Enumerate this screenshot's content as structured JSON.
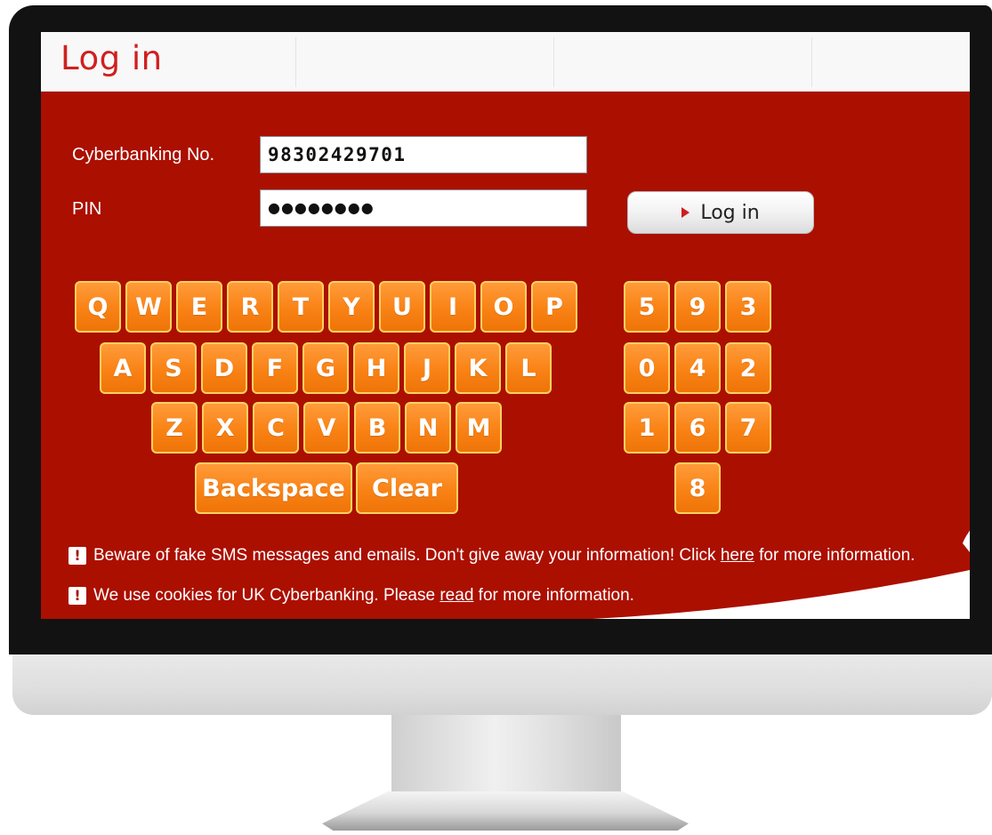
{
  "page": {
    "title": "Log in"
  },
  "form": {
    "cyberbanking_label": "Cyberbanking No.",
    "cyberbanking_value": "98302429701",
    "pin_label": "PIN",
    "pin_value": "●●●●●●●●",
    "login_button": "Log in"
  },
  "keyboard": {
    "row1": [
      "Q",
      "W",
      "E",
      "R",
      "T",
      "Y",
      "U",
      "I",
      "O",
      "P"
    ],
    "row2": [
      "A",
      "S",
      "D",
      "F",
      "G",
      "H",
      "J",
      "K",
      "L"
    ],
    "row3": [
      "Z",
      "X",
      "C",
      "V",
      "B",
      "N",
      "M"
    ],
    "backspace": "Backspace",
    "clear": "Clear"
  },
  "numpad": {
    "row1": [
      "5",
      "9",
      "3"
    ],
    "row2": [
      "0",
      "4",
      "2"
    ],
    "row3": [
      "1",
      "6",
      "7"
    ],
    "row4": [
      "8"
    ]
  },
  "notices": {
    "fake_sms_before": "Beware of fake SMS messages and emails. Don't give away your information! Click",
    "fake_sms_link": "here",
    "fake_sms_after": "for more information.",
    "cookies_before": "We use cookies for UK Cyberbanking. Please",
    "cookies_link": "read",
    "cookies_after": "for more information."
  },
  "icons": {
    "warning": "!",
    "login_arrow": "play-icon"
  },
  "colors": {
    "background_red": "#ab0f00",
    "key_orange": "#f98215",
    "title_red": "#d11f1f"
  }
}
